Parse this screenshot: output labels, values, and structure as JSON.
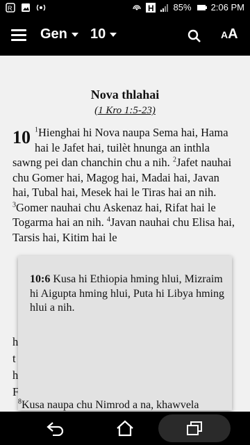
{
  "status_bar": {
    "battery": "85%",
    "time": "2:06 PM",
    "icons": [
      "alarm-icon",
      "image-icon",
      "radio-icon",
      "hotspot-icon",
      "h-network-icon",
      "signal-icon",
      "battery-icon"
    ]
  },
  "toolbar": {
    "book": "Gen",
    "chapter": "10",
    "font_button": "A"
  },
  "content": {
    "heading": "Nova thlahai",
    "cross_reference": "(1 Kro 1:5-23)",
    "chapter_number": "10",
    "verses": [
      {
        "num": "1",
        "text": "Hienghai hi Nova naupa Sema hai, Hama hai le Jafet hai, tuilèt hnunga an inthla sawng pei dan chanchin chu a nih."
      },
      {
        "num": "2",
        "text": "Jafet nauhai chu Gomer hai, Magog hai, Madai hai, Javan hai, Tubal hai, Mesek hai le Tiras hai an nih."
      },
      {
        "num": "3",
        "text": "Gomer nauhai chu Askenaz hai, Rifat hai le Togarma hai an nih."
      },
      {
        "num": "4",
        "text": "Javan nauhai chu Elisa hai, Tarsis hai, Kitim hai le"
      }
    ],
    "partial_line_letters": [
      "h",
      "t",
      "h",
      "F"
    ],
    "bottom_verse_num": "8",
    "bottom_verse_text": "Kusa naupa chu Nimrod a na, khawvela"
  },
  "popup": {
    "ref": "10:6",
    "text": "Kusa hi Ethiopia hming hlui, Mizraim hi Aigupta hming hlui, Puta hi Libya hming hlui a nih."
  }
}
